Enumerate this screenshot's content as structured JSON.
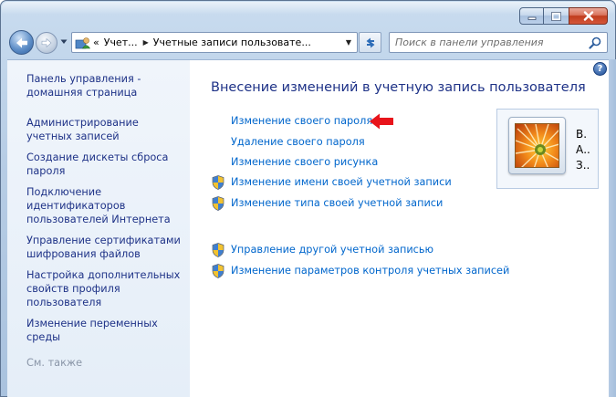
{
  "window": {
    "caption_buttons": [
      "minimize",
      "maximize",
      "close"
    ]
  },
  "navigation": {
    "address_overflow": "«",
    "breadcrumbs": [
      "Учет...",
      "Учетные записи пользовате..."
    ],
    "search_placeholder": "Поиск в панели управления"
  },
  "sidebar": {
    "items": [
      {
        "label": "Панель управления - домашняя страница"
      },
      {
        "label": "Администрирование учетных записей"
      },
      {
        "label": "Создание дискеты сброса пароля"
      },
      {
        "label": "Подключение идентификаторов пользователей Интернета"
      },
      {
        "label": "Управление сертификатами шифрования файлов"
      },
      {
        "label": "Настройка дополнительных свойств профиля пользователя"
      },
      {
        "label": "Изменение переменных среды"
      }
    ],
    "see_also": "См. также"
  },
  "main": {
    "help_glyph": "?",
    "title": "Внесение изменений в учетную запись пользователя",
    "tasks": [
      {
        "label": "Изменение своего пароля",
        "shield": false
      },
      {
        "label": "Удаление своего пароля",
        "shield": false
      },
      {
        "label": "Изменение своего рисунка",
        "shield": false
      },
      {
        "label": "Изменение имени своей учетной записи",
        "shield": true
      },
      {
        "label": "Изменение типа своей учетной записи",
        "shield": true
      }
    ],
    "other_tasks": [
      {
        "label": "Управление другой учетной записью",
        "shield": true
      },
      {
        "label": "Изменение параметров контроля учетных записей",
        "shield": true
      }
    ]
  },
  "account": {
    "name": "В.",
    "type": "А..",
    "status": "З.."
  },
  "colors": {
    "link": "#0066cc",
    "heading": "#1e3287",
    "annotation_arrow": "#e8141b"
  }
}
